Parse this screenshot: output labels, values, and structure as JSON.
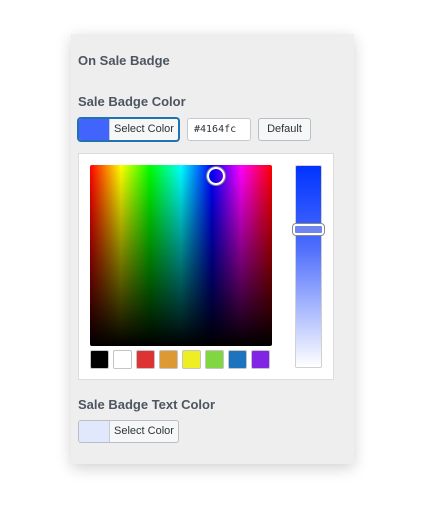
{
  "section": {
    "title": "On Sale Badge"
  },
  "badge_color": {
    "label": "Sale Badge Color",
    "swatch": "#4164fc",
    "select_label": "Select Color",
    "hex_value": "#4164fc",
    "default_label": "Default",
    "palette": [
      "#000000",
      "#ffffff",
      "#dd3333",
      "#dd9933",
      "#eeee22",
      "#81d742",
      "#1e73be",
      "#8224e3"
    ]
  },
  "text_color": {
    "label": "Sale Badge Text Color",
    "swatch": "#e1e7fd",
    "select_label": "Select Color"
  }
}
